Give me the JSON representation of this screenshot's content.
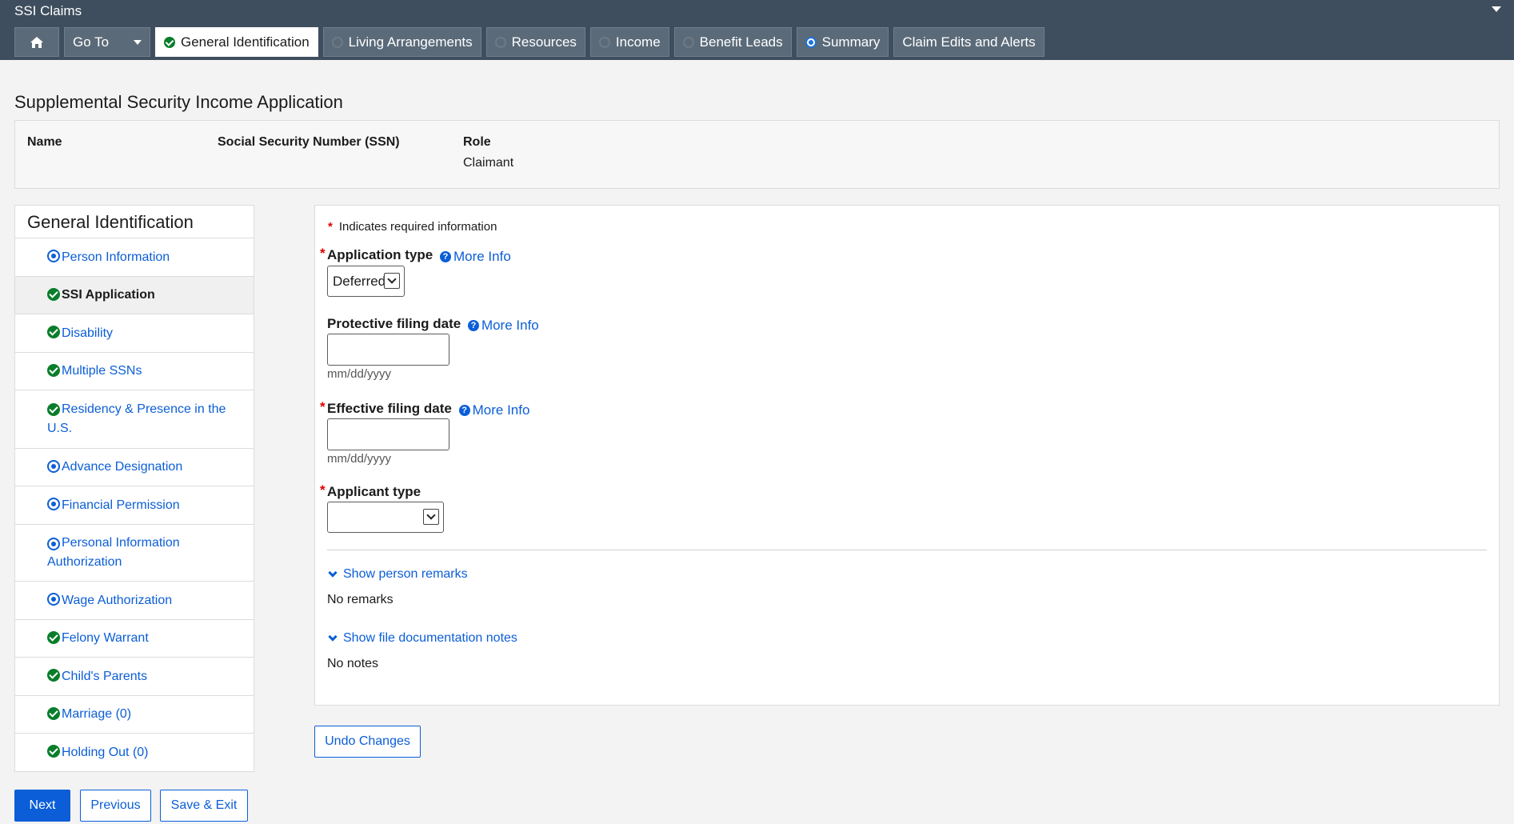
{
  "app": {
    "title": "SSI Claims"
  },
  "nav": {
    "home_icon": "home-icon",
    "goto_label": "Go To",
    "tabs": [
      {
        "label": "General Identification",
        "status": "complete",
        "active": true
      },
      {
        "label": "Living Arrangements",
        "status": "not-started",
        "active": false
      },
      {
        "label": "Resources",
        "status": "not-started",
        "active": false
      },
      {
        "label": "Income",
        "status": "not-started",
        "active": false
      },
      {
        "label": "Benefit Leads",
        "status": "not-started",
        "active": false
      },
      {
        "label": "Summary",
        "status": "in-progress",
        "active": false
      },
      {
        "label": "Claim Edits and Alerts",
        "status": "none",
        "active": false
      }
    ]
  },
  "page": {
    "title": "Supplemental Security Income Application"
  },
  "info": {
    "name_label": "Name",
    "name_value": "",
    "ssn_label": "Social Security Number (SSN)",
    "ssn_value": "",
    "role_label": "Role",
    "role_value": "Claimant"
  },
  "sidenav": {
    "heading": "General Identification",
    "items": [
      {
        "label": "Person Information",
        "status": "in-progress"
      },
      {
        "label": "SSI Application",
        "status": "complete",
        "current": true
      },
      {
        "label": "Disability",
        "status": "complete"
      },
      {
        "label": "Multiple SSNs",
        "status": "complete"
      },
      {
        "label": "Residency & Presence in the U.S.",
        "status": "complete"
      },
      {
        "label": "Advance Designation",
        "status": "in-progress"
      },
      {
        "label": "Financial Permission",
        "status": "in-progress"
      },
      {
        "label": "Personal Information Authorization",
        "status": "in-progress"
      },
      {
        "label": "Wage Authorization",
        "status": "in-progress"
      },
      {
        "label": "Felony Warrant",
        "status": "complete"
      },
      {
        "label": "Child's Parents",
        "status": "complete"
      },
      {
        "label": "Marriage (0)",
        "status": "complete"
      },
      {
        "label": "Holding Out (0)",
        "status": "complete"
      }
    ]
  },
  "form": {
    "required_note": "Indicates required information",
    "required_star": "*",
    "more_info": "More Info",
    "application_type": {
      "label": "Application type",
      "value": "Deferred"
    },
    "protective_date": {
      "label": "Protective filing date",
      "value": "",
      "hint": "mm/dd/yyyy"
    },
    "effective_date": {
      "label": "Effective filing date",
      "value": "",
      "hint": "mm/dd/yyyy"
    },
    "applicant_type": {
      "label": "Applicant type",
      "value": ""
    },
    "show_remarks": "Show person remarks",
    "remarks": "No remarks",
    "show_notes": "Show file documentation notes",
    "notes": "No notes"
  },
  "buttons": {
    "undo": "Undo Changes",
    "next": "Next",
    "previous": "Previous",
    "save_exit": "Save & Exit"
  },
  "colors": {
    "header": "#3e4e5e",
    "link": "#0b5ed7",
    "complete": "#0a7d2b",
    "required": "#dd0000"
  }
}
